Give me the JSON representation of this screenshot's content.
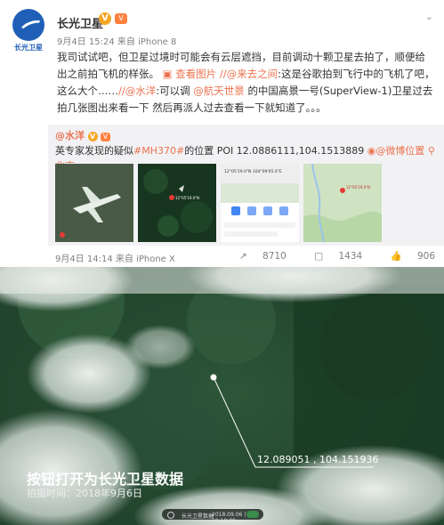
{
  "post": {
    "avatar_text": "长光卫星",
    "author": "长光卫星",
    "verified_glyph": "V",
    "level_glyph": "㊎",
    "menu_icon": "chevron-down-icon",
    "meta": "9月4日 15:24 来自 iPhone 8",
    "content_main": "我司试试吧，但卫星过境时可能会有云层遮挡，目前调动十颗卫星去拍了，顺便给出之前拍飞机的样张。",
    "view_image": "查看图片",
    "mention_1": "//@来去之间",
    "content_2": ":这是谷歌拍到飞行中的飞机了吧，这么大个……",
    "mention_2": "//@水洋",
    "content_3": ":可以调",
    "mention_3": "@航天世景",
    "content_4": "的中国高景一号(SuperView-1)卫星过去拍几张图出来看一下 然后再派人过去查看一下就知道了。。。"
  },
  "quote": {
    "author": "@水洋",
    "text_prefix": "英专家发现的疑似",
    "hashtag": "#MH370#",
    "text_suffix": "的位置 POI 12.0886111,104.1513889",
    "location_link": "@微博位置",
    "place": "北京",
    "footer": "9月4日 14:14 来自 iPhone X",
    "phone_coord": "12°05'19.0\"N 104°09'05.0\"E"
  },
  "actions": {
    "share_icon": "share-icon",
    "share_count": "8710",
    "comment_icon": "comment-icon",
    "comment_count": "1434",
    "like_icon": "like-icon",
    "like_count": "906"
  },
  "satellite": {
    "coordinates": "12.089051 , 104.151936",
    "watermark_title": "按钮打开为长光卫星数据",
    "watermark_date": "拍摄时间：2018年9月6日",
    "control_label": "长光卫星数据",
    "control_date": "2018.09.06 | 10:10:00"
  }
}
